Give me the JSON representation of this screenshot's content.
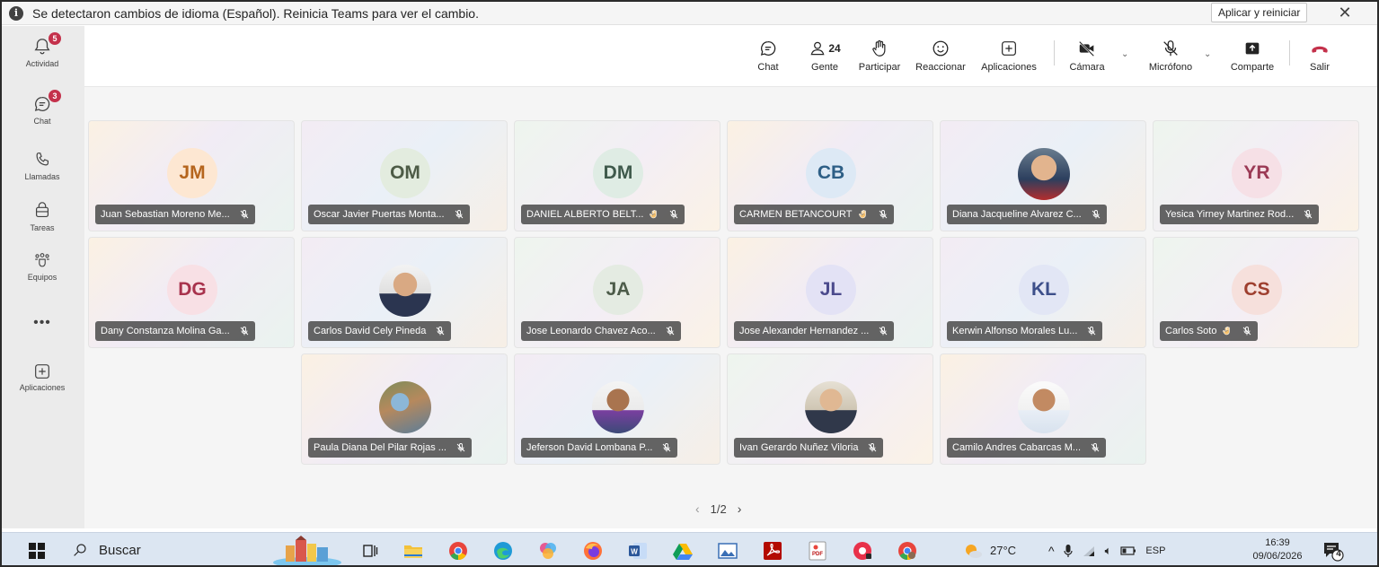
{
  "notification": {
    "message": "Se detectaron cambios de idioma (Español). Reinicia Teams para ver el cambio.",
    "apply_label": "Aplicar y reiniciar"
  },
  "rail": {
    "items": [
      {
        "label": "Actividad",
        "badge": "5"
      },
      {
        "label": "Chat",
        "badge": "3"
      },
      {
        "label": "Llamadas"
      },
      {
        "label": "Tareas"
      },
      {
        "label": "Equipos"
      },
      {
        "label": "•••"
      },
      {
        "label": "Aplicaciones"
      }
    ]
  },
  "toolbar": {
    "chat": "Chat",
    "people": "Gente",
    "people_count": "24",
    "raise": "Participar",
    "react": "Reaccionar",
    "apps": "Aplicaciones",
    "camera": "Cámara",
    "mic": "Micrófono",
    "share": "Comparte",
    "leave": "Salir"
  },
  "participants": [
    {
      "name": "Juan Sebastian Moreno Me...",
      "initials": "JM",
      "avatar_bg": "#fde7d2",
      "avatar_fg": "#b5651d",
      "hand": false
    },
    {
      "name": "Oscar Javier Puertas Monta...",
      "initials": "OM",
      "avatar_bg": "#e3ecdf",
      "avatar_fg": "#4d5b46",
      "hand": false
    },
    {
      "name": "DANIEL ALBERTO BELT...",
      "initials": "DM",
      "avatar_bg": "#dfece4",
      "avatar_fg": "#3f5a4c",
      "hand": true
    },
    {
      "name": "CARMEN BETANCOURT",
      "initials": "CB",
      "avatar_bg": "#dde9f5",
      "avatar_fg": "#2e5f86",
      "hand": true
    },
    {
      "name": "Diana Jacqueline Alvarez C...",
      "initials": "",
      "photo": true,
      "hand": false
    },
    {
      "name": "Yesica Yirney Martinez Rod...",
      "initials": "YR",
      "avatar_bg": "#f6e0e6",
      "avatar_fg": "#9b3a55",
      "hand": false
    },
    {
      "name": "Dany Constanza Molina Ga...",
      "initials": "DG",
      "avatar_bg": "#f8e0e5",
      "avatar_fg": "#a8334d",
      "hand": false
    },
    {
      "name": "Carlos David Cely Pineda",
      "initials": "",
      "photo": true,
      "hand": false
    },
    {
      "name": "Jose Leonardo Chavez Aco...",
      "initials": "JA",
      "avatar_bg": "#e4ebe2",
      "avatar_fg": "#4c5b49",
      "hand": false
    },
    {
      "name": "Jose Alexander Hernandez ...",
      "initials": "JL",
      "avatar_bg": "#e3e2f5",
      "avatar_fg": "#4b4a8c",
      "hand": false
    },
    {
      "name": "Kerwin Alfonso Morales Lu...",
      "initials": "KL",
      "avatar_bg": "#e2e6f5",
      "avatar_fg": "#3d4f8a",
      "hand": false
    },
    {
      "name": "Carlos Soto",
      "initials": "CS",
      "avatar_bg": "#f6e0dc",
      "avatar_fg": "#9e3f2f",
      "hand": true
    },
    {
      "name": "Paula Diana Del Pilar Rojas ...",
      "initials": "",
      "photo": true,
      "hand": false
    },
    {
      "name": "Jeferson David Lombana P...",
      "initials": "",
      "photo": true,
      "hand": false
    },
    {
      "name": "Ivan Gerardo Nuñez Viloria",
      "initials": "",
      "photo": true,
      "hand": false
    },
    {
      "name": "Camilo Andres Cabarcas M...",
      "initials": "",
      "photo": true,
      "hand": false
    }
  ],
  "pager": {
    "text": "1/2"
  },
  "taskbar": {
    "search_label": "Buscar",
    "weather": "27°C",
    "lang": "ESP",
    "time": "16:39",
    "date": "09/06/2026",
    "notif_count": "4"
  },
  "colors": {
    "accent": "#5b5fc7",
    "leave": "#c4314b",
    "badge": "#c4314b",
    "rail_bg": "#ebebeb"
  }
}
